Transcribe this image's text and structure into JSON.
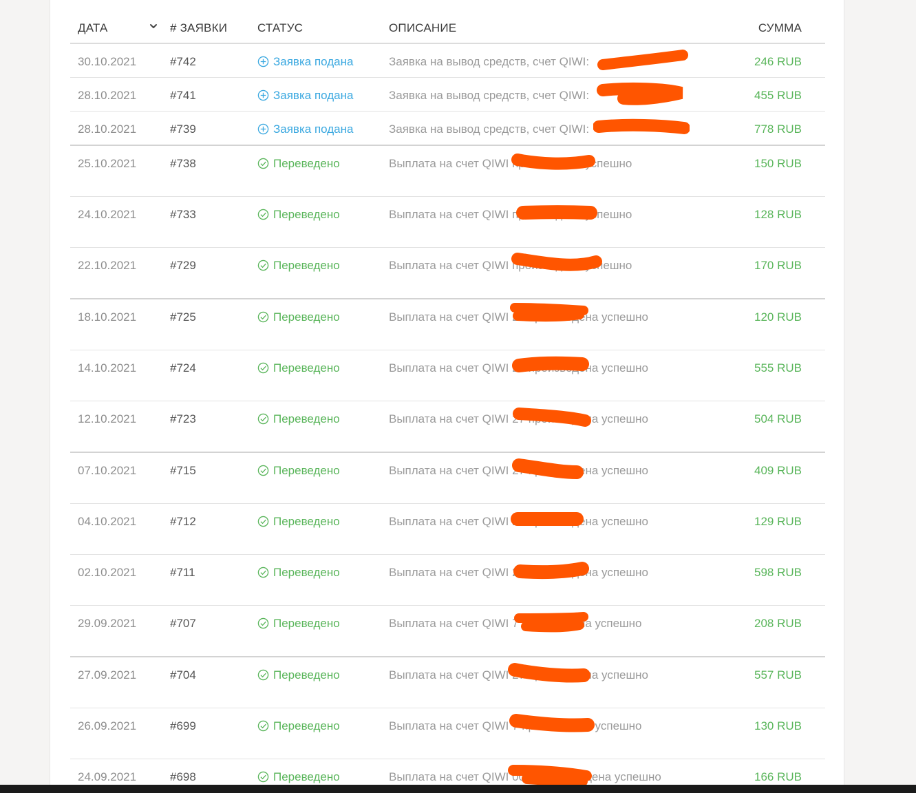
{
  "table": {
    "headers": {
      "date": "ДАТА",
      "number": "# ЗАЯВКИ",
      "status": "СТАТУС",
      "description": "ОПИСАНИЕ",
      "sum": "СУММА"
    },
    "rows": [
      {
        "date": "30.10.2021",
        "number": "#742",
        "status": "Заявка подана",
        "description": "Заявка на вывод средств, счет QIWI:",
        "sum": "246 RUB"
      },
      {
        "date": "28.10.2021",
        "number": "#741",
        "status": "Заявка подана",
        "description": "Заявка на вывод средств, счет QIWI:",
        "sum": "455 RUB"
      },
      {
        "date": "28.10.2021",
        "number": "#739",
        "status": "Заявка подана",
        "description": "Заявка на вывод средств, счет QIWI:",
        "sum": "778 RUB"
      },
      {
        "date": "25.10.2021",
        "number": "#738",
        "status": "Переведено",
        "description": "Выплата на счет QIWI произведена успешно",
        "sum": "150 RUB"
      },
      {
        "date": "24.10.2021",
        "number": "#733",
        "status": "Переведено",
        "description": "Выплата на счет QIWI произведена успешно",
        "sum": "128 RUB"
      },
      {
        "date": "22.10.2021",
        "number": "#729",
        "status": "Переведено",
        "description": "Выплата на счет QIWI произведена успешно",
        "sum": "170 RUB"
      },
      {
        "date": "18.10.2021",
        "number": "#725",
        "status": "Переведено",
        "description": "Выплата на счет QIWI 27 произведена успешно",
        "sum": "120 RUB"
      },
      {
        "date": "14.10.2021",
        "number": "#724",
        "status": "Переведено",
        "description": "Выплата на счет QIWI 27 произведена успешно",
        "sum": "555 RUB"
      },
      {
        "date": "12.10.2021",
        "number": "#723",
        "status": "Переведено",
        "description": "Выплата на счет QIWI 27 произведена успешно",
        "sum": "504 RUB"
      },
      {
        "date": "07.10.2021",
        "number": "#715",
        "status": "Переведено",
        "description": "Выплата на счет QIWI 27 произведена успешно",
        "sum": "409 RUB"
      },
      {
        "date": "04.10.2021",
        "number": "#712",
        "status": "Переведено",
        "description": "Выплата на счет QIWI 27 произведена успешно",
        "sum": "129 RUB"
      },
      {
        "date": "02.10.2021",
        "number": "#711",
        "status": "Переведено",
        "description": "Выплата на счет QIWI 27 произведена успешно",
        "sum": "598 RUB"
      },
      {
        "date": "29.09.2021",
        "number": "#707",
        "status": "Переведено",
        "description": "Выплата на счет QIWI 7 произведена успешно",
        "sum": "208 RUB"
      },
      {
        "date": "27.09.2021",
        "number": "#704",
        "status": "Переведено",
        "description": "Выплата на счет QIWI 27 произведена успешно",
        "sum": "557 RUB"
      },
      {
        "date": "26.09.2021",
        "number": "#699",
        "status": "Переведено",
        "description": "Выплата на счет QIWI 7 произведена успешно",
        "sum": "130 RUB"
      },
      {
        "date": "24.09.2021",
        "number": "#698",
        "status": "Переведено",
        "description": "Выплата на счет QIWI 0027 произведена успешно",
        "sum": "166 RUB"
      }
    ]
  },
  "colors": {
    "pending": "#3aa8e0",
    "done": "#59b55a",
    "redaction": "#ff5500"
  },
  "icons": {
    "pending": "plus-circle-icon",
    "done": "check-circle-icon",
    "sort": "chevron-down-icon"
  }
}
